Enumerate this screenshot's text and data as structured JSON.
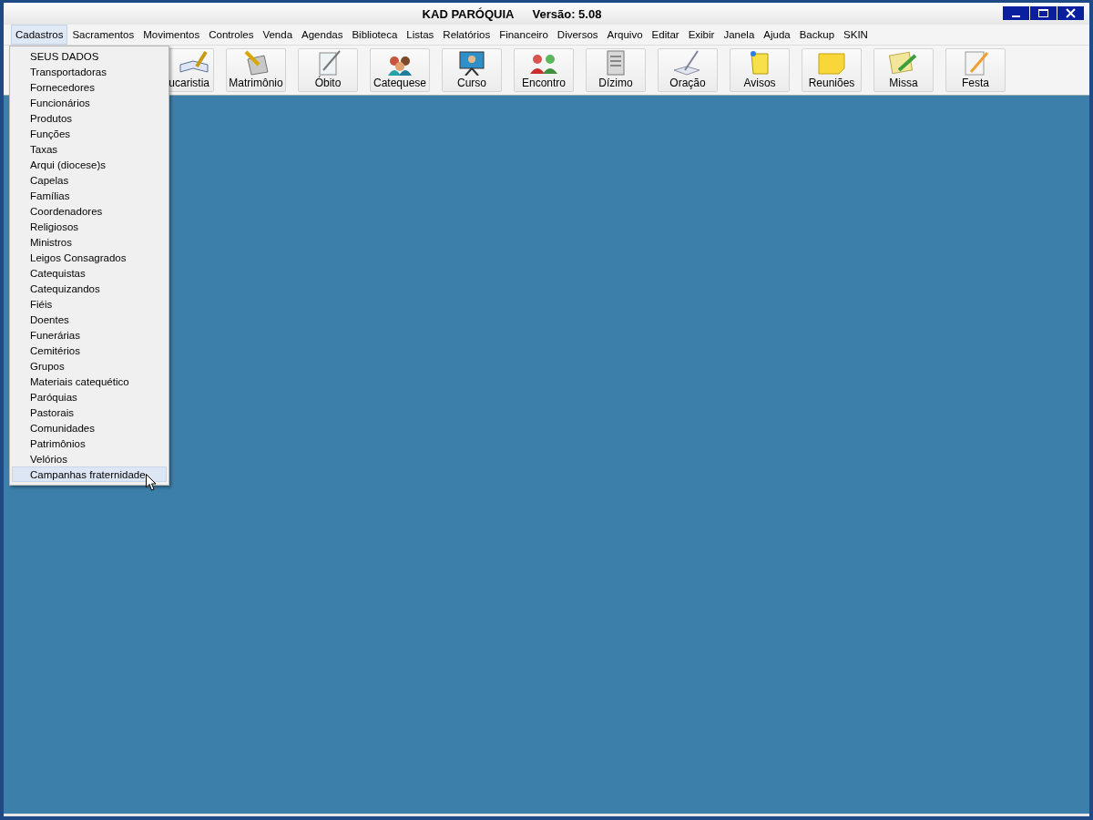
{
  "window": {
    "title": "KAD PARÓQUIA",
    "version": "Versão: 5.08"
  },
  "menu_bar": [
    {
      "label": "Cadastros",
      "selected": true
    },
    {
      "label": "Sacramentos",
      "selected": false
    },
    {
      "label": "Movimentos",
      "selected": false
    },
    {
      "label": "Controles",
      "selected": false
    },
    {
      "label": "Venda",
      "selected": false
    },
    {
      "label": "Agendas",
      "selected": false
    },
    {
      "label": "Biblioteca",
      "selected": false
    },
    {
      "label": "Listas",
      "selected": false
    },
    {
      "label": "Relatórios",
      "selected": false
    },
    {
      "label": "Financeiro",
      "selected": false
    },
    {
      "label": "Diversos",
      "selected": false
    },
    {
      "label": "Arquivo",
      "selected": false
    },
    {
      "label": "Editar",
      "selected": false
    },
    {
      "label": "Exibir",
      "selected": false
    },
    {
      "label": "Janela",
      "selected": false
    },
    {
      "label": "Ajuda",
      "selected": false
    },
    {
      "label": "Backup",
      "selected": false
    },
    {
      "label": "SKIN",
      "selected": false
    }
  ],
  "toolbar": [
    "ucaristia",
    "Matrimônio",
    "Óbito",
    "Catequese",
    "Curso",
    "Encontro",
    "Dízimo",
    "Oração",
    "Avisos",
    "Reuniões",
    "Missa",
    "Festa"
  ],
  "dropdown_menu": [
    {
      "label": "SEUS DADOS",
      "selected": false
    },
    {
      "label": "Transportadoras",
      "selected": false
    },
    {
      "label": "Fornecedores",
      "selected": false
    },
    {
      "label": "Funcionários",
      "selected": false
    },
    {
      "label": "Produtos",
      "selected": false
    },
    {
      "label": "Funções",
      "selected": false
    },
    {
      "label": "Taxas",
      "selected": false
    },
    {
      "label": "Arqui (diocese)s",
      "selected": false
    },
    {
      "label": "Capelas",
      "selected": false
    },
    {
      "label": "Famílias",
      "selected": false
    },
    {
      "label": "Coordenadores",
      "selected": false
    },
    {
      "label": "Religiosos",
      "selected": false
    },
    {
      "label": "Ministros",
      "selected": false
    },
    {
      "label": "Leigos Consagrados",
      "selected": false
    },
    {
      "label": "Catequistas",
      "selected": false
    },
    {
      "label": "Catequizandos",
      "selected": false
    },
    {
      "label": "Fiéis",
      "selected": false
    },
    {
      "label": "Doentes",
      "selected": false
    },
    {
      "label": "Funerárias",
      "selected": false
    },
    {
      "label": "Cemitérios",
      "selected": false
    },
    {
      "label": "Grupos",
      "selected": false
    },
    {
      "label": "Materiais catequético",
      "selected": false
    },
    {
      "label": "Paróquias",
      "selected": false
    },
    {
      "label": "Pastorais",
      "selected": false
    },
    {
      "label": "Comunidades",
      "selected": false
    },
    {
      "label": "Patrimônios",
      "selected": false
    },
    {
      "label": "Velórios",
      "selected": false
    },
    {
      "label": "Campanhas fraternidade",
      "selected": true
    }
  ]
}
